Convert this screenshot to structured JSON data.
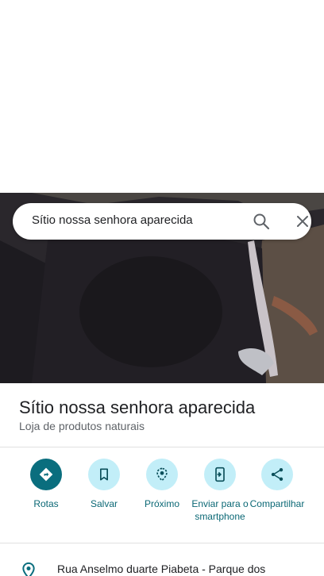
{
  "search": {
    "query": "Sítio nossa senhora aparecida"
  },
  "place": {
    "name": "Sítio nossa senhora aparecida",
    "category": "Loja de produtos naturais",
    "address": "Rua Anselmo duarte Piabeta - Parque dos"
  },
  "actions": [
    {
      "label": "Rotas",
      "icon": "directions-icon"
    },
    {
      "label": "Salvar",
      "icon": "bookmark-icon"
    },
    {
      "label": "Próximo",
      "icon": "nearby-icon"
    },
    {
      "label": "Enviar para o smartphone",
      "icon": "send-to-phone-icon"
    },
    {
      "label": "Compartilhar",
      "icon": "share-icon"
    }
  ],
  "colors": {
    "accent": "#0a6e7e",
    "action_bg": "#c2eef8",
    "action_label": "#0b6875"
  }
}
